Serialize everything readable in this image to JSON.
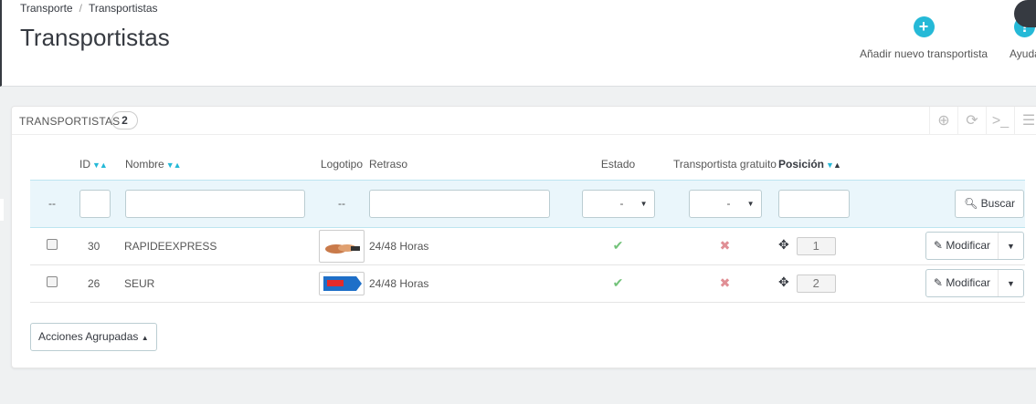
{
  "breadcrumb": {
    "parent": "Transporte",
    "separator": "/",
    "current": "Transportistas"
  },
  "page_title": "Transportistas",
  "toolbar": {
    "add_label": "Añadir nuevo transportista",
    "add_icon": "plus-circle-icon",
    "help_label": "Ayuda",
    "help_icon": "question-circle-icon"
  },
  "panel": {
    "title": "TRANSPORTISTAS",
    "count": "2",
    "header_icons": [
      "add-icon",
      "refresh-icon",
      "sql-icon",
      "database-icon"
    ]
  },
  "table": {
    "headers": {
      "id": "ID",
      "name": "Nombre",
      "logo": "Logotipo",
      "delay": "Retraso",
      "status": "Estado",
      "free": "Transportista gratuito",
      "position": "Posición"
    },
    "filter": {
      "empty_marker": "--",
      "logo_marker": "--",
      "status_value": "-",
      "free_value": "-",
      "search_label": "Buscar"
    },
    "rows": [
      {
        "id": "30",
        "name": "RAPIDEEXPRESS",
        "delay": "24/48 Horas",
        "active": true,
        "free": false,
        "position": "1",
        "action": "Modificar"
      },
      {
        "id": "26",
        "name": "SEUR",
        "delay": "24/48 Horas",
        "active": true,
        "free": false,
        "position": "2",
        "action": "Modificar"
      }
    ]
  },
  "bulk_actions_label": "Acciones Agrupadas",
  "colors": {
    "accent": "#25b9d7",
    "success": "#72c279",
    "danger": "#e08f95"
  }
}
